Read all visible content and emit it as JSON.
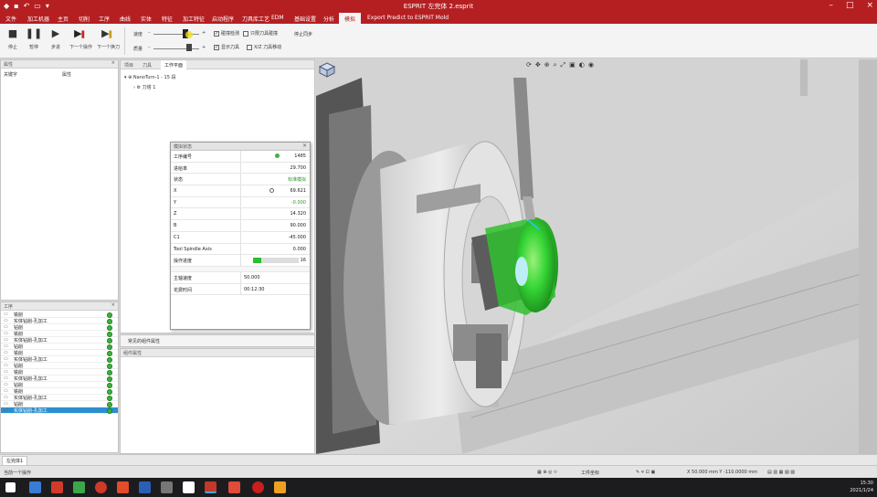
{
  "titlebar": {
    "title": "ESPRIT 左完体 2.esprit"
  },
  "tabs": [
    {
      "label": "文件"
    },
    {
      "label": "加工机器"
    },
    {
      "label": "主页"
    },
    {
      "label": "切削"
    },
    {
      "label": "工序"
    },
    {
      "label": "曲线"
    },
    {
      "label": "实体"
    },
    {
      "label": "特征"
    },
    {
      "label": "加工特征"
    },
    {
      "label": "启动程序"
    },
    {
      "label": "刀具库工艺"
    },
    {
      "label": "EDM"
    },
    {
      "label": "基础设置"
    },
    {
      "label": "分析"
    },
    {
      "label": "模拟"
    },
    {
      "label": "Export Predict to ESPRIT Mold"
    }
  ],
  "ribbon": {
    "buttons": [
      {
        "label": "停止",
        "icon": "stop-icon"
      },
      {
        "label": "暂停",
        "icon": "pause-icon"
      },
      {
        "label": "步进",
        "icon": "step-icon"
      },
      {
        "label": "下一个操作",
        "icon": "next-operation-icon"
      },
      {
        "label": "下一个换刀",
        "icon": "next-toolchange-icon"
      }
    ],
    "speed_label": "速度",
    "quality_label": "质量",
    "checkboxes": [
      {
        "label": "碰撞检测",
        "checked": true
      },
      {
        "label": "只限刀具碰撞",
        "checked": false
      },
      {
        "label": "显示刀具",
        "checked": true
      },
      {
        "label": "X/Z 刀具移动",
        "checked": false
      }
    ],
    "sync_label": "停止同步"
  },
  "left_top": {
    "header": "属性",
    "col1": "关键字",
    "col2": "属性"
  },
  "left_bot": {
    "header": "工序",
    "operations": [
      {
        "label": "铣削",
        "icon": "op-icon",
        "selected": false
      },
      {
        "label": "实体钻削-孔加工",
        "icon": "op-icon",
        "selected": false
      },
      {
        "label": "钻削",
        "icon": "op-icon",
        "selected": false
      },
      {
        "label": "铣削",
        "icon": "op-icon",
        "selected": false
      },
      {
        "label": "实体钻削-孔加工",
        "icon": "op-icon",
        "selected": false
      },
      {
        "label": "钻削",
        "icon": "op-icon",
        "selected": false
      },
      {
        "label": "铣削",
        "icon": "op-icon",
        "selected": false
      },
      {
        "label": "实体钻削-孔加工",
        "icon": "op-icon",
        "selected": false
      },
      {
        "label": "钻削",
        "icon": "op-icon",
        "selected": false
      },
      {
        "label": "铣削",
        "icon": "op-icon",
        "selected": false
      },
      {
        "label": "实体钻削-孔加工",
        "icon": "op-icon",
        "selected": false
      },
      {
        "label": "钻削",
        "icon": "op-icon",
        "selected": false
      },
      {
        "label": "铣削",
        "icon": "op-icon",
        "selected": false
      },
      {
        "label": "实体钻削-孔加工",
        "icon": "op-icon",
        "selected": false
      },
      {
        "label": "钻削",
        "icon": "op-icon",
        "selected": false
      },
      {
        "label": "实体钻削-孔加工",
        "icon": "op-icon",
        "selected": true
      }
    ]
  },
  "mid_top": {
    "tabs": [
      {
        "label": "项目"
      },
      {
        "label": "刀具"
      },
      {
        "label": "工作平面"
      }
    ],
    "tree_root": "NanoTurn-1 - 15 段",
    "tree_child": "刀塔 1"
  },
  "mid_bar": {
    "label": "常见的组件属性"
  },
  "mid_bot": {
    "header": "组件属性"
  },
  "sim": {
    "header": "模拟状态",
    "rows": [
      {
        "key": "工序编号",
        "value": "1485",
        "style": "dot"
      },
      {
        "key": "进给率",
        "value": "29.700",
        "style": ""
      },
      {
        "key": "状态",
        "value": "标准模拟",
        "style": "green"
      },
      {
        "key": "X",
        "value": "69.621",
        "style": "clock"
      },
      {
        "key": "Y",
        "value": "-0.000",
        "style": "green"
      },
      {
        "key": "Z",
        "value": "14.320",
        "style": ""
      },
      {
        "key": "B",
        "value": "90.000",
        "style": ""
      },
      {
        "key": "C1",
        "value": "-45.000",
        "style": ""
      },
      {
        "key": "Tool Spindle Axis",
        "value": "0.000",
        "style": ""
      },
      {
        "key": "操作进度",
        "value": "16",
        "style": "bar",
        "progress": 0.18
      }
    ],
    "rows2": [
      {
        "key": "主轴速度",
        "value": "50.000"
      },
      {
        "key": "花费时间",
        "value": "00:12:30"
      }
    ]
  },
  "docbar": {
    "tab": "左完体1"
  },
  "status": {
    "left": "当前一个操作",
    "coords": "X 50.000 mm  Y -110.0000 mm",
    "mode": "工件坐标"
  },
  "tray": {
    "time": "15:30",
    "date": "2021/1/24"
  }
}
